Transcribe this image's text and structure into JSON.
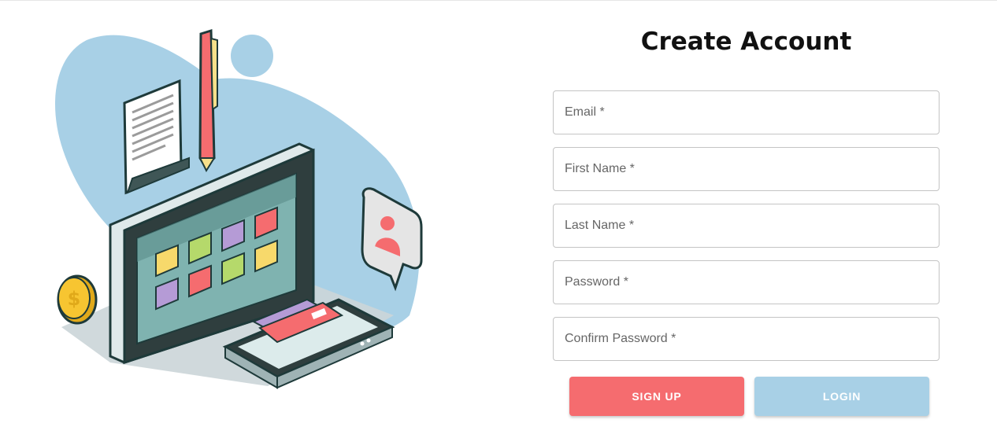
{
  "header": {
    "title": "Create Account"
  },
  "form": {
    "fields": [
      {
        "name": "email",
        "placeholder": "Email *",
        "value": ""
      },
      {
        "name": "first_name",
        "placeholder": "First Name *",
        "value": ""
      },
      {
        "name": "last_name",
        "placeholder": "Last Name *",
        "value": ""
      },
      {
        "name": "password",
        "placeholder": "Password *",
        "value": ""
      },
      {
        "name": "confirm_password",
        "placeholder": "Confirm Password *",
        "value": ""
      }
    ]
  },
  "actions": {
    "signup_label": "SIGN UP",
    "login_label": "LOGIN"
  },
  "colors": {
    "signup": "#f56c6f",
    "login": "#a8d0e6",
    "blob": "#a8d0e6"
  },
  "illustration": {
    "name": "computer-signup-illustration"
  }
}
